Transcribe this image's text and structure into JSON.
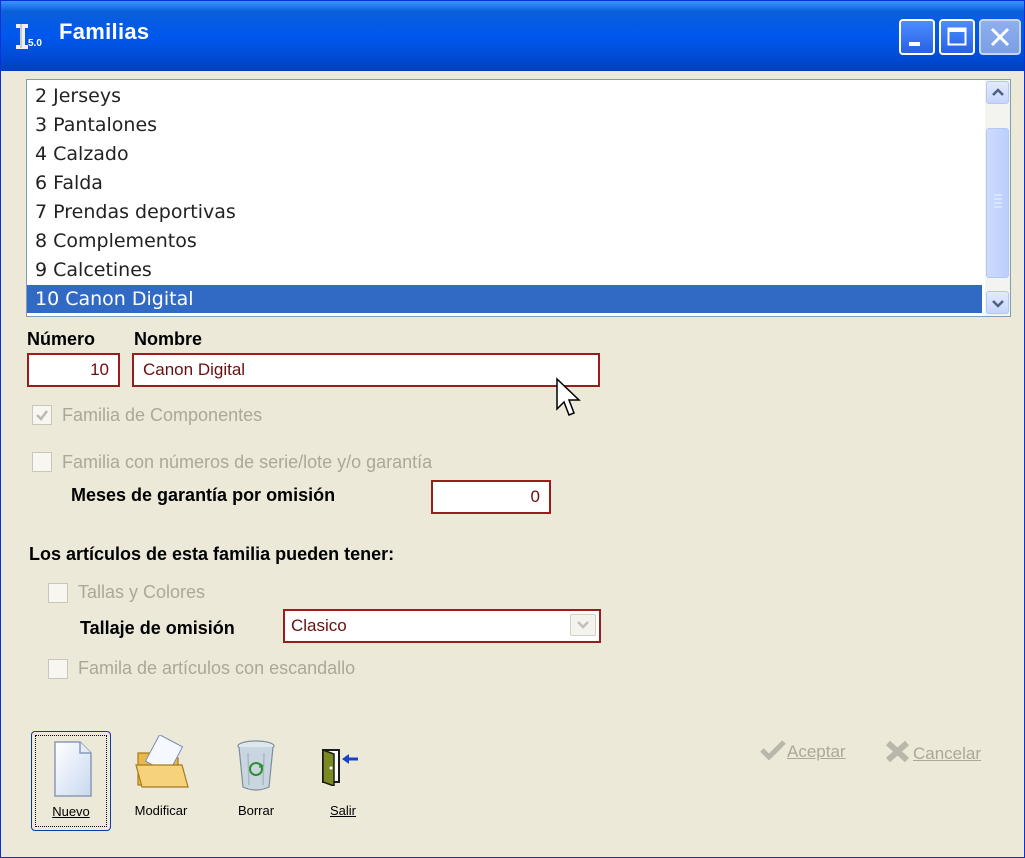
{
  "window": {
    "title": "Familias",
    "icon_text": "5.0",
    "controls": [
      "minimize",
      "maximize",
      "close"
    ]
  },
  "family_list": {
    "items": [
      {
        "label": "2 Jerseys"
      },
      {
        "label": "3 Pantalones"
      },
      {
        "label": "4 Calzado"
      },
      {
        "label": "6 Falda"
      },
      {
        "label": "7 Prendas deportivas"
      },
      {
        "label": "8 Complementos"
      },
      {
        "label": "9 Calcetines"
      },
      {
        "label": "10 Canon Digital",
        "selected": true
      }
    ]
  },
  "form": {
    "numero_label": "Número",
    "nombre_label": "Nombre",
    "numero_value": "10",
    "nombre_value": "Canon Digital",
    "familia_componentes": {
      "label": "Familia de Componentes",
      "checked": true,
      "enabled": false
    },
    "familia_serie": {
      "label": "Familia con números de serie/lote y/o garantía",
      "checked": false,
      "enabled": false
    },
    "meses_label": "Meses de garantía por omisión",
    "meses_value": "0",
    "articulos_heading": "Los artículos de esta familia pueden tener:",
    "tallas_colores": {
      "label": "Tallas y Colores",
      "checked": false,
      "enabled": false
    },
    "tallaje_label": "Tallaje de omisión",
    "tallaje_value": "Clasico",
    "escandallo": {
      "label": "Famila de artículos con escandallo",
      "checked": false,
      "enabled": false
    }
  },
  "toolbar": {
    "nuevo": "Nuevo",
    "modificar": "Modificar",
    "borrar": "Borrar",
    "salir": "Salir"
  },
  "dialog": {
    "aceptar": "Aceptar",
    "cancelar": "Cancelar"
  },
  "colors": {
    "title_blue": "#0058ee",
    "selection": "#316ac5",
    "field_border": "#9a1d1d",
    "disabled_text": "#aca899",
    "face": "#ece9d8"
  }
}
